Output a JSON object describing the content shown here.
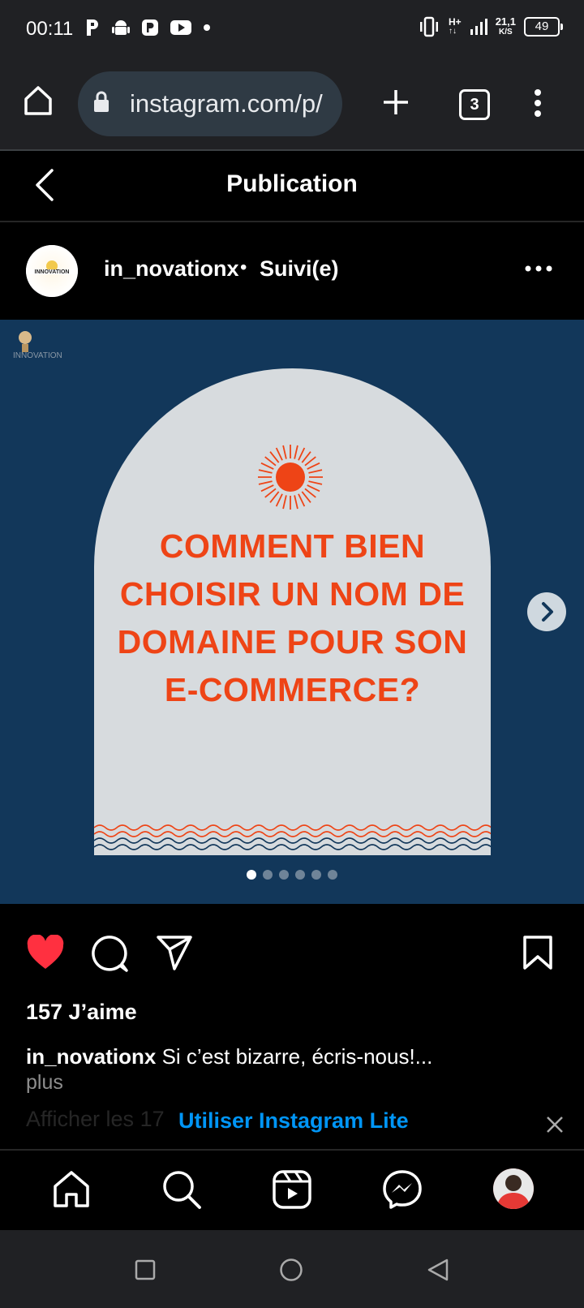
{
  "status_bar": {
    "time": "00:11",
    "network": "H+",
    "speed_top": "21,1",
    "speed_bottom": "K/S",
    "battery": "49",
    "left_icons": [
      "p-app-icon",
      "android-icon",
      "p-badge-icon",
      "youtube-icon",
      "dot-icon"
    ],
    "right_icons": [
      "vibrate-icon",
      "signal-icon",
      "battery-icon"
    ]
  },
  "browser": {
    "url": "instagram.com/p/",
    "tab_count": "3",
    "icons": [
      "home-icon",
      "lock-icon",
      "plus-icon",
      "tabs-icon",
      "kebab-menu-icon"
    ]
  },
  "header": {
    "title": "Publication"
  },
  "post": {
    "username": "in_novationx",
    "separator": "•",
    "follow_status": "Suivi(e)",
    "image_headline_lines": [
      "COMMENT BIEN",
      "CHOISIR UN NOM DE",
      "DOMAINE POUR SON",
      "E-COMMERCE?"
    ],
    "logo_text": "INNOVATION",
    "carousel": {
      "count": 6,
      "active_index": 0
    }
  },
  "engagement": {
    "likes": "157 J’aime",
    "caption_user": "in_novationx",
    "caption_text": " Si c’est bizarre, écris-nous!...",
    "more": "plus",
    "comments_faded": "Afficher les 17",
    "lite_banner": "Utiliser Instagram Lite"
  },
  "colors": {
    "post_bg": "#12375a",
    "arch": "#d7dbde",
    "accent_orange": "#ee4416",
    "like_red": "#ff3040",
    "link_blue": "#0095f6"
  },
  "bottom_nav": [
    "home-icon",
    "search-icon",
    "reels-icon",
    "messenger-icon",
    "profile-avatar"
  ],
  "system_nav": [
    "recents-square-icon",
    "home-circle-icon",
    "back-triangle-icon"
  ]
}
